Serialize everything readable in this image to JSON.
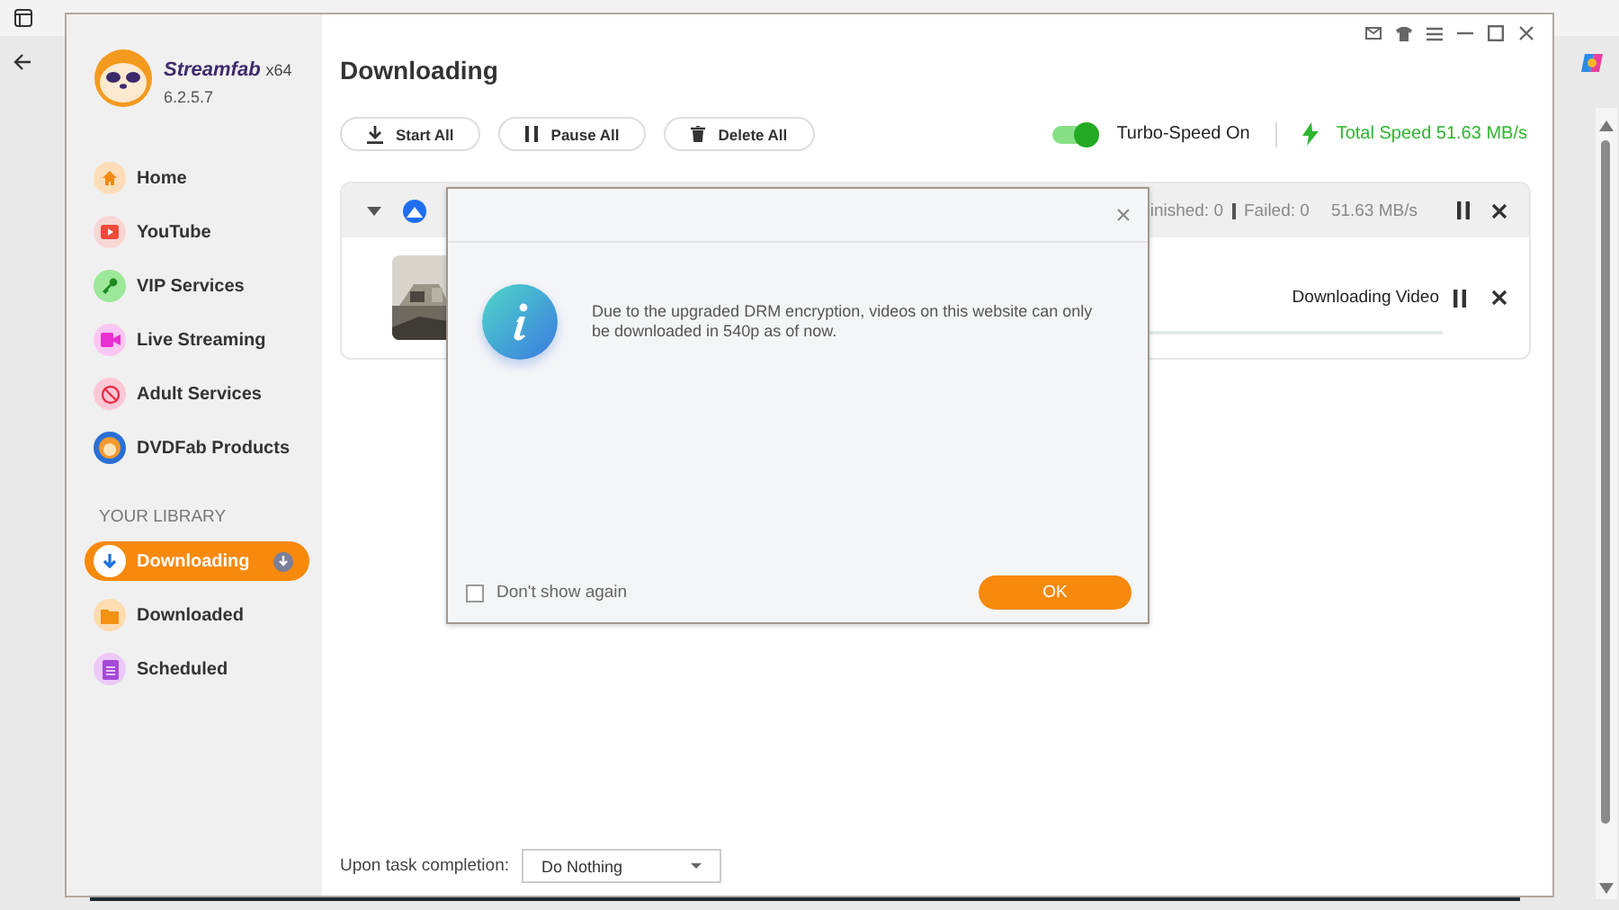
{
  "app": {
    "name": "Streamfab",
    "edition": "x64",
    "version": "6.2.5.7"
  },
  "sidebar": {
    "services": [
      {
        "label": "Home",
        "kind": "home"
      },
      {
        "label": "YouTube",
        "kind": "youtube"
      },
      {
        "label": "VIP Services",
        "kind": "vip"
      },
      {
        "label": "Live Streaming",
        "kind": "live"
      },
      {
        "label": "Adult Services",
        "kind": "adult"
      },
      {
        "label": "DVDFab Products",
        "kind": "dvdfab"
      }
    ],
    "library_heading": "YOUR LIBRARY",
    "library": [
      {
        "label": "Downloading",
        "kind": "downloading",
        "selected": true
      },
      {
        "label": "Downloaded",
        "kind": "downloaded",
        "selected": false
      },
      {
        "label": "Scheduled",
        "kind": "scheduled",
        "selected": false
      }
    ]
  },
  "main": {
    "title": "Downloading",
    "toolbar": [
      {
        "label": "Start All",
        "kind": "start"
      },
      {
        "label": "Pause All",
        "kind": "pause"
      },
      {
        "label": "Delete All",
        "kind": "delete"
      }
    ],
    "turbo": {
      "label": "Turbo-Speed On",
      "on": true
    },
    "total_speed": "Total Speed 51.63 MB/s",
    "task_group": {
      "expanded": true,
      "finished": "inished: 0",
      "failed": "Failed: 0",
      "speed": "51.63 MB/s",
      "task": {
        "status": "Downloading Video"
      }
    },
    "footer": {
      "label": "Upon task completion:",
      "select": {
        "value": "Do Nothing"
      }
    }
  },
  "dialog": {
    "message": "Due to the upgraded DRM encryption, videos on this website can only be downloaded in 540p as of now.",
    "checkbox": {
      "label": "Don't show again",
      "checked": false
    },
    "ok_button": "OK"
  }
}
